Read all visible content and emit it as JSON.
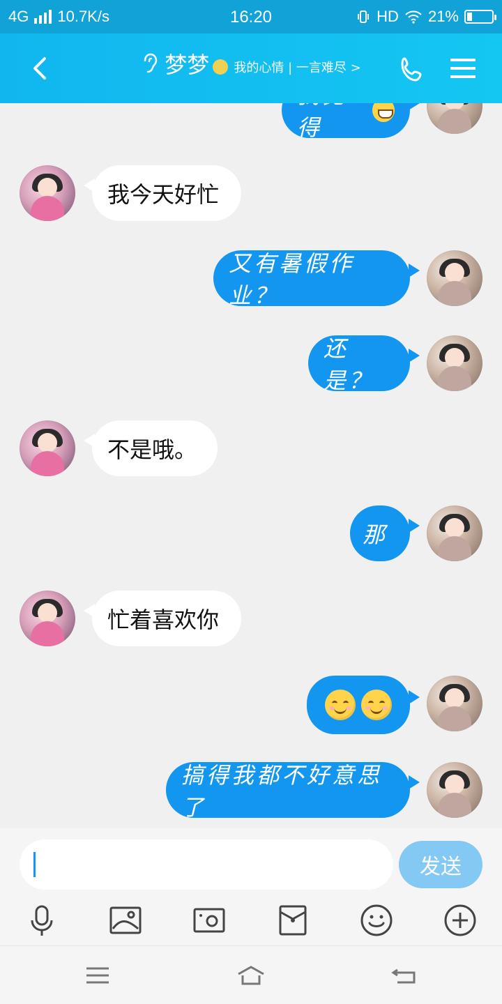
{
  "status": {
    "network": "4G",
    "speed": "10.7K/s",
    "time": "16:20",
    "hd": "HD",
    "battery": "21%"
  },
  "header": {
    "title": "梦梦",
    "subtitle": "我的心情 | 一言难尽 >"
  },
  "chat": {
    "top_partial": "我觉得",
    "messages": [
      {
        "side": "in",
        "text": "我今天好忙"
      },
      {
        "side": "out",
        "text": "又有暑假作业？"
      },
      {
        "side": "out",
        "text": "还是？"
      },
      {
        "side": "in",
        "text": "不是哦。"
      },
      {
        "side": "out",
        "text": "那"
      },
      {
        "side": "in",
        "text": "忙着喜欢你"
      },
      {
        "side": "out",
        "emoji": "smile-face"
      },
      {
        "side": "out",
        "text": "搞得我都不好意思了"
      }
    ]
  },
  "input": {
    "placeholder": "",
    "send_label": "发送"
  },
  "tools": [
    "microphone-icon",
    "image-icon",
    "camera-icon",
    "red-envelope-icon",
    "emoji-icon",
    "plus-icon"
  ],
  "colors": {
    "header_bg": "#14c6f2",
    "bubble_out": "#1296f0",
    "bubble_in": "#ffffff",
    "send_bg": "#83c9f4"
  }
}
